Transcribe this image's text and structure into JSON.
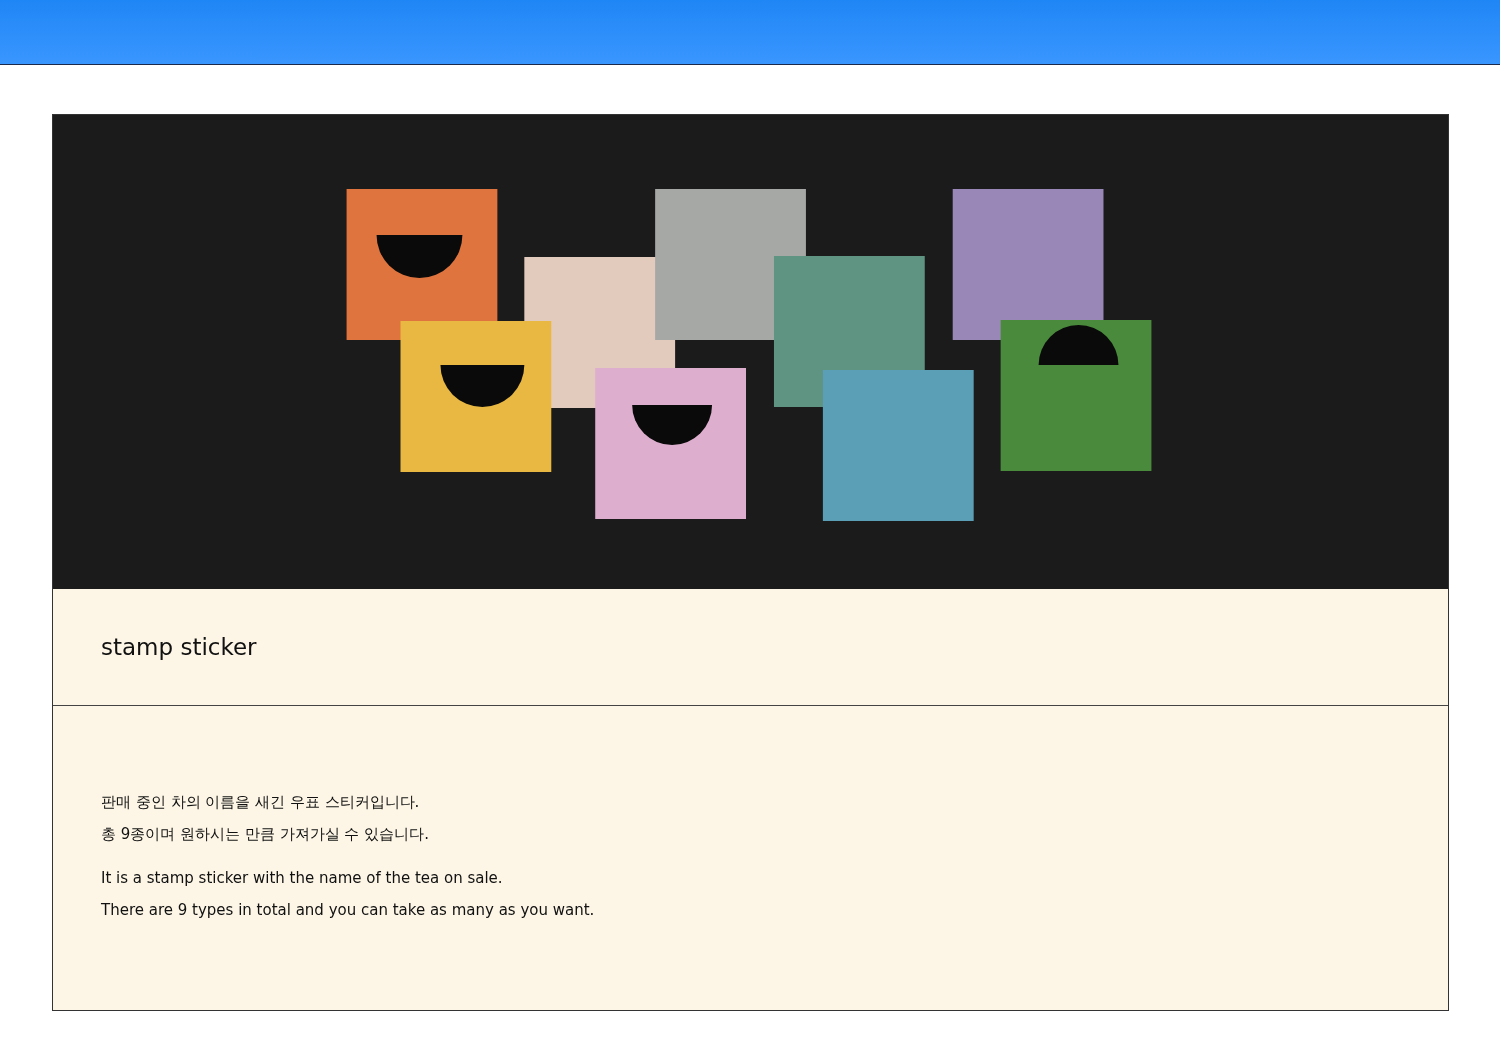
{
  "section": {
    "title": "stamp sticker"
  },
  "description": {
    "paragraphs": [
      [
        "판매 중인 차의 이름을 새긴 우표 스티커입니다.",
        "총 9종이며 원하시는 만큼 가져가실 수 있습니다."
      ],
      [
        "It is a stamp sticker with the name of the tea on sale.",
        "There are 9 types in total and you can take as many as you want."
      ]
    ]
  }
}
